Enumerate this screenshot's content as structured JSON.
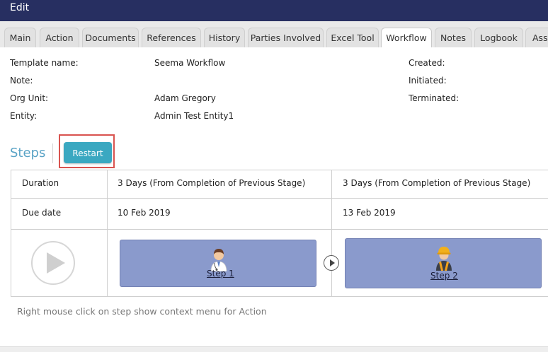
{
  "window": {
    "title": "Edit"
  },
  "tabs": [
    {
      "label": "Main"
    },
    {
      "label": "Action"
    },
    {
      "label": "Documents"
    },
    {
      "label": "References"
    },
    {
      "label": "History"
    },
    {
      "label": "Parties Involved"
    },
    {
      "label": "Excel Tool"
    },
    {
      "label": "Workflow",
      "active": true
    },
    {
      "label": "Notes"
    },
    {
      "label": "Logbook"
    },
    {
      "label": "Assi"
    }
  ],
  "info": {
    "template_name_label": "Template name:",
    "template_name_value": "Seema Workflow",
    "note_label": "Note:",
    "org_unit_label": "Org Unit:",
    "org_unit_value": "Adam Gregory",
    "entity_label": "Entity:",
    "entity_value": "Admin Test Entity1",
    "created_label": "Created:",
    "initiated_label": "Initiated:",
    "terminated_label": "Terminated:"
  },
  "steps": {
    "title": "Steps",
    "restart_label": "Restart",
    "duration_label": "Duration",
    "due_date_label": "Due date",
    "columns": [
      {
        "duration": "3 Days (From Completion of Previous Stage)",
        "due_date": "10 Feb 2019",
        "step_label": "Step 1",
        "icon": "doctor-icon"
      },
      {
        "duration": "3 Days (From Completion of Previous Stage)",
        "due_date": "13 Feb 2019",
        "step_label": "Step 2",
        "icon": "worker-icon"
      }
    ],
    "hint": "Right mouse click on step show context menu for Action"
  },
  "colors": {
    "titlebar": "#272f61",
    "steps_title": "#5aa3c6",
    "restart_button": "#3aa8c1",
    "highlight": "#d9534f",
    "step_box": "#8a9acc"
  }
}
